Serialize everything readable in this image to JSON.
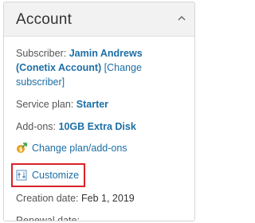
{
  "panel": {
    "title": "Account",
    "subscriber_label": "Subscriber:",
    "subscriber_name": "Jamin Andrews (Conetix Account)",
    "change_subscriber": "[Change subscriber]",
    "service_plan_label": "Service plan:",
    "service_plan_value": "Starter",
    "addons_label": "Add-ons:",
    "addons_value": "10GB Extra Disk",
    "change_plan_link": "Change plan/add-ons",
    "customize_link": "Customize",
    "creation_date_label": "Creation date:",
    "creation_date_value": "Feb 1, 2019",
    "renewal_date_label": "Renewal date:",
    "renewal_date_value": "—"
  },
  "icons": {
    "collapse": "chevron-up-icon",
    "change_plan": "plan-change-icon",
    "customize": "customize-icon"
  },
  "colors": {
    "link": "#1c6fa6",
    "highlight": "#d9232a",
    "header_bg": "#f2f2f2"
  }
}
